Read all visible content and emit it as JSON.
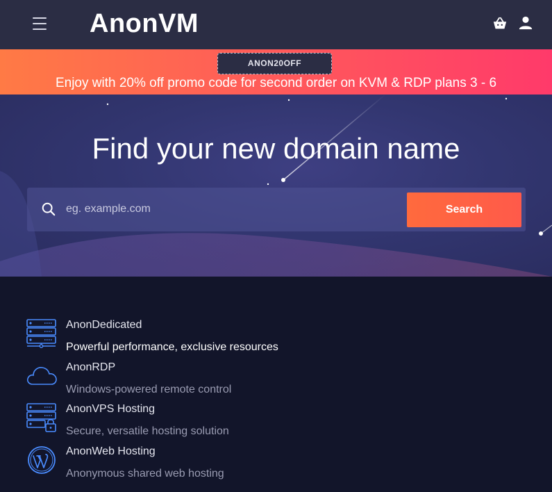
{
  "header": {
    "logo": "AnonVM",
    "menu_icon": "hamburger-menu-icon",
    "cart_icon": "basket-icon",
    "user_icon": "user-icon"
  },
  "promo": {
    "code": "ANON20OFF",
    "text": "Enjoy with 20% off promo code for second order on KVM & RDP plans 3 - 6"
  },
  "hero": {
    "title": "Find your new domain name",
    "search_placeholder": "eg. example.com",
    "search_button": "Search"
  },
  "services": [
    {
      "title": "AnonDedicated",
      "description": "Powerful performance, exclusive resources",
      "icon": "server-icon"
    },
    {
      "title": "AnonRDP",
      "description": "Windows-powered remote control",
      "icon": "cloud-icon"
    },
    {
      "title": "AnonVPS Hosting",
      "description": "Secure, versatile hosting solution",
      "icon": "server-lock-icon"
    },
    {
      "title": "AnonWeb Hosting",
      "description": "Anonymous shared web hosting",
      "icon": "wordpress-icon"
    }
  ],
  "colors": {
    "topbar": "#2b2d44",
    "promo_start": "#ff7a45",
    "promo_end": "#ff3a6a",
    "accent": "#ff6a3d",
    "icon_blue": "#4a8cff",
    "background": "#12152a"
  }
}
